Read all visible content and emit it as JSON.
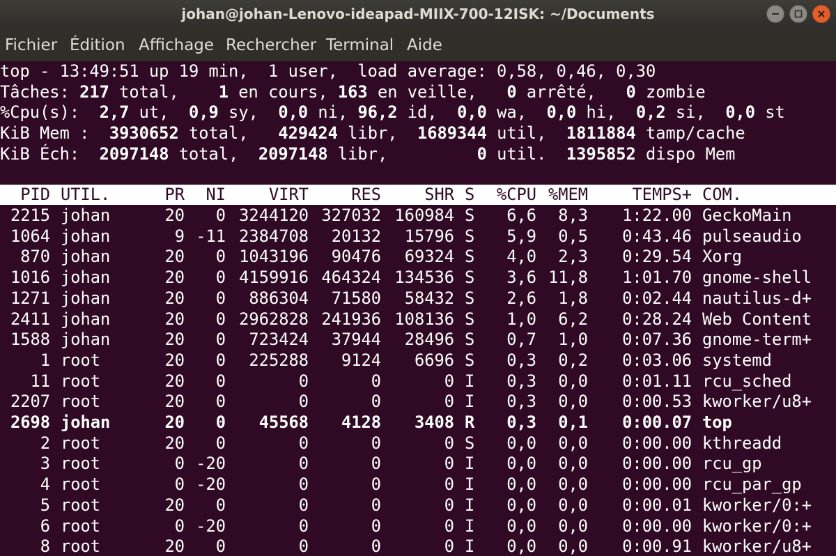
{
  "window": {
    "title": "johan@johan-Lenovo-ideapad-MIIX-700-12ISK: ~/Documents"
  },
  "menu": [
    "Fichier",
    "Édition",
    "Affichage",
    "Rechercher",
    "Terminal",
    "Aide"
  ],
  "summary": {
    "line1": "top - 13:49:51 up 19 min,  1 user,  load average: 0,58, 0,46, 0,30",
    "line2": [
      [
        "Tâches: ",
        false
      ],
      [
        "217",
        true
      ],
      [
        " total,    ",
        false
      ],
      [
        "1",
        true
      ],
      [
        " en cours, ",
        false
      ],
      [
        "163",
        true
      ],
      [
        " en veille,   ",
        false
      ],
      [
        "0",
        true
      ],
      [
        " arrêté,   ",
        false
      ],
      [
        "0",
        true
      ],
      [
        " zombie",
        false
      ]
    ],
    "line3": [
      [
        "%Cpu(s):  ",
        false
      ],
      [
        "2,7",
        true
      ],
      [
        " ut,  ",
        false
      ],
      [
        "0,9",
        true
      ],
      [
        " sy,  ",
        false
      ],
      [
        "0,0",
        true
      ],
      [
        " ni, ",
        false
      ],
      [
        "96,2",
        true
      ],
      [
        " id,  ",
        false
      ],
      [
        "0,0",
        true
      ],
      [
        " wa,  ",
        false
      ],
      [
        "0,0",
        true
      ],
      [
        " hi,  ",
        false
      ],
      [
        "0,2",
        true
      ],
      [
        " si,  ",
        false
      ],
      [
        "0,0",
        true
      ],
      [
        " st",
        false
      ]
    ],
    "line4": [
      [
        "KiB Mem :  ",
        false
      ],
      [
        "3930652",
        true
      ],
      [
        " total,   ",
        false
      ],
      [
        "429424",
        true
      ],
      [
        " libr,  ",
        false
      ],
      [
        "1689344",
        true
      ],
      [
        " util,  ",
        false
      ],
      [
        "1811884",
        true
      ],
      [
        " tamp/cache",
        false
      ]
    ],
    "line5": [
      [
        "KiB Éch:  ",
        false
      ],
      [
        "2097148",
        true
      ],
      [
        " total,  ",
        false
      ],
      [
        "2097148",
        true
      ],
      [
        " libr,         ",
        false
      ],
      [
        "0",
        true
      ],
      [
        " util.  ",
        false
      ],
      [
        "1395852",
        true
      ],
      [
        " dispo Mem",
        false
      ]
    ]
  },
  "table": {
    "headers": [
      "PID",
      "UTIL.",
      "PR",
      "NI",
      "VIRT",
      "RES",
      "SHR",
      "S",
      "%CPU",
      "%MEM",
      "TEMPS+",
      "COM."
    ],
    "rows": [
      [
        "2215",
        "johan",
        "20",
        "0",
        "3244120",
        "327032",
        "160984",
        "S",
        "6,6",
        "8,3",
        "1:22.00",
        "GeckoMain"
      ],
      [
        "1064",
        "johan",
        "9",
        "-11",
        "2384708",
        "20132",
        "15796",
        "S",
        "5,9",
        "0,5",
        "0:43.46",
        "pulseaudio"
      ],
      [
        "870",
        "johan",
        "20",
        "0",
        "1043196",
        "90476",
        "69324",
        "S",
        "4,0",
        "2,3",
        "0:29.54",
        "Xorg"
      ],
      [
        "1016",
        "johan",
        "20",
        "0",
        "4159916",
        "464324",
        "134536",
        "S",
        "3,6",
        "11,8",
        "1:01.70",
        "gnome-shell"
      ],
      [
        "1271",
        "johan",
        "20",
        "0",
        "886304",
        "71580",
        "58432",
        "S",
        "2,6",
        "1,8",
        "0:02.44",
        "nautilus-d+"
      ],
      [
        "2411",
        "johan",
        "20",
        "0",
        "2962828",
        "241936",
        "108136",
        "S",
        "1,0",
        "6,2",
        "0:28.24",
        "Web Content"
      ],
      [
        "1588",
        "johan",
        "20",
        "0",
        "723424",
        "37944",
        "28496",
        "S",
        "0,7",
        "1,0",
        "0:07.36",
        "gnome-term+"
      ],
      [
        "1",
        "root",
        "20",
        "0",
        "225288",
        "9124",
        "6696",
        "S",
        "0,3",
        "0,2",
        "0:03.06",
        "systemd"
      ],
      [
        "11",
        "root",
        "20",
        "0",
        "0",
        "0",
        "0",
        "I",
        "0,3",
        "0,0",
        "0:01.11",
        "rcu_sched"
      ],
      [
        "2207",
        "root",
        "20",
        "0",
        "0",
        "0",
        "0",
        "I",
        "0,3",
        "0,0",
        "0:00.53",
        "kworker/u8+"
      ],
      [
        "2698",
        "johan",
        "20",
        "0",
        "45568",
        "4128",
        "3408",
        "R",
        "0,3",
        "0,1",
        "0:00.07",
        "top"
      ],
      [
        "2",
        "root",
        "20",
        "0",
        "0",
        "0",
        "0",
        "S",
        "0,0",
        "0,0",
        "0:00.00",
        "kthreadd"
      ],
      [
        "3",
        "root",
        "0",
        "-20",
        "0",
        "0",
        "0",
        "I",
        "0,0",
        "0,0",
        "0:00.00",
        "rcu_gp"
      ],
      [
        "4",
        "root",
        "0",
        "-20",
        "0",
        "0",
        "0",
        "I",
        "0,0",
        "0,0",
        "0:00.00",
        "rcu_par_gp"
      ],
      [
        "5",
        "root",
        "20",
        "0",
        "0",
        "0",
        "0",
        "I",
        "0,0",
        "0,0",
        "0:00.01",
        "kworker/0:+"
      ],
      [
        "6",
        "root",
        "0",
        "-20",
        "0",
        "0",
        "0",
        "I",
        "0,0",
        "0,0",
        "0:00.00",
        "kworker/0:+"
      ],
      [
        "8",
        "root",
        "20",
        "0",
        "0",
        "0",
        "0",
        "I",
        "0,0",
        "0,0",
        "0:00.91",
        "kworker/u8+"
      ]
    ],
    "bold_pid": "2698"
  },
  "colors": {
    "terminal_bg": "#300a24",
    "text": "#ffffff",
    "header_bg": "#ffffff",
    "close_button": "#e05f2c"
  }
}
